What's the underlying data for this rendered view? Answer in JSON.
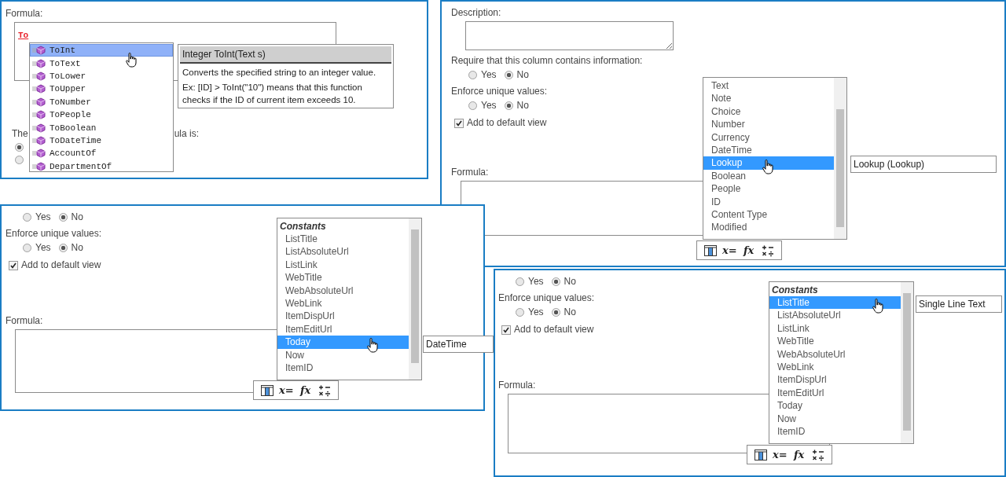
{
  "panels": [
    {
      "kind": "autocomplete",
      "formula_label": "Formula:",
      "formula_value": "To",
      "functions": [
        {
          "label": "ToInt",
          "selected": true
        },
        {
          "label": "ToText",
          "selected": false
        },
        {
          "label": "ToLower",
          "selected": false
        },
        {
          "label": "ToUpper",
          "selected": false
        },
        {
          "label": "ToNumber",
          "selected": false
        },
        {
          "label": "ToPeople",
          "selected": false
        },
        {
          "label": "ToBoolean",
          "selected": false
        },
        {
          "label": "ToDateTime",
          "selected": false
        },
        {
          "label": "AccountOf",
          "selected": false
        },
        {
          "label": "DepartmentOf",
          "selected": false
        }
      ],
      "tooltip": {
        "signature": "Integer ToInt(Text s)",
        "description": "Converts the specified string to an integer value.",
        "example": "Ex: [ID] > ToInt(\"10\") means that this function checks if the ID of current item exceeds 10."
      },
      "result_label_start": "The",
      "result_label_end": "ula is:",
      "result_options": [
        {
          "selected": true
        },
        {
          "selected": false
        }
      ]
    },
    {
      "kind": "settings",
      "description_label": "Description:",
      "require_label": "Require that this column contains information:",
      "require_options": [
        {
          "label": "Yes",
          "selected": false
        },
        {
          "label": "No",
          "selected": true
        }
      ],
      "unique_label": "Enforce unique values:",
      "unique_options": [
        {
          "label": "Yes",
          "selected": false
        },
        {
          "label": "No",
          "selected": true
        }
      ],
      "default_view": {
        "label": "Add to default view",
        "checked": true
      },
      "formula_label": "Formula:",
      "items": [
        {
          "label": "Text",
          "selected": false
        },
        {
          "label": "Note",
          "selected": false
        },
        {
          "label": "Choice",
          "selected": false
        },
        {
          "label": "Number",
          "selected": false
        },
        {
          "label": "Currency",
          "selected": false
        },
        {
          "label": "DateTime",
          "selected": false
        },
        {
          "label": "Lookup",
          "selected": true
        },
        {
          "label": "Boolean",
          "selected": false
        },
        {
          "label": "People",
          "selected": false
        },
        {
          "label": "ID",
          "selected": false
        },
        {
          "label": "Content Type",
          "selected": false
        },
        {
          "label": "Modified",
          "selected": false
        }
      ],
      "type_value": "Lookup (Lookup)",
      "toolbar": [
        {
          "kind": "fields"
        },
        {
          "kind": "glyph",
          "text": "x="
        },
        {
          "kind": "glyph",
          "text": "fx"
        },
        {
          "kind": "operators"
        }
      ]
    },
    {
      "kind": "settings",
      "require_options": [
        {
          "label": "Yes",
          "selected": false
        },
        {
          "label": "No",
          "selected": true
        }
      ],
      "unique_label": "Enforce unique values:",
      "unique_options": [
        {
          "label": "Yes",
          "selected": false
        },
        {
          "label": "No",
          "selected": true
        }
      ],
      "default_view": {
        "label": "Add to default view",
        "checked": true
      },
      "formula_label": "Formula:",
      "list_heading": "Constants",
      "items": [
        {
          "label": "ListTitle",
          "selected": false
        },
        {
          "label": "ListAbsoluteUrl",
          "selected": false
        },
        {
          "label": "ListLink",
          "selected": false
        },
        {
          "label": "WebTitle",
          "selected": false
        },
        {
          "label": "WebAbsoluteUrl",
          "selected": false
        },
        {
          "label": "WebLink",
          "selected": false
        },
        {
          "label": "ItemDispUrl",
          "selected": false
        },
        {
          "label": "ItemEditUrl",
          "selected": false
        },
        {
          "label": "Today",
          "selected": true
        },
        {
          "label": "Now",
          "selected": false
        },
        {
          "label": "ItemID",
          "selected": false
        }
      ],
      "type_value": "DateTime",
      "toolbar": [
        {
          "kind": "fields"
        },
        {
          "kind": "glyph",
          "text": "x="
        },
        {
          "kind": "glyph",
          "text": "fx"
        },
        {
          "kind": "operators"
        }
      ]
    },
    {
      "kind": "settings",
      "require_options": [
        {
          "label": "Yes",
          "selected": false
        },
        {
          "label": "No",
          "selected": true
        }
      ],
      "unique_label": "Enforce unique values:",
      "unique_options": [
        {
          "label": "Yes",
          "selected": false
        },
        {
          "label": "No",
          "selected": true
        }
      ],
      "default_view": {
        "label": "Add to default view",
        "checked": true
      },
      "formula_label": "Formula:",
      "list_heading": "Constants",
      "items": [
        {
          "label": "ListTitle",
          "selected": true
        },
        {
          "label": "ListAbsoluteUrl",
          "selected": false
        },
        {
          "label": "ListLink",
          "selected": false
        },
        {
          "label": "WebTitle",
          "selected": false
        },
        {
          "label": "WebAbsoluteUrl",
          "selected": false
        },
        {
          "label": "WebLink",
          "selected": false
        },
        {
          "label": "ItemDispUrl",
          "selected": false
        },
        {
          "label": "ItemEditUrl",
          "selected": false
        },
        {
          "label": "Today",
          "selected": false
        },
        {
          "label": "Now",
          "selected": false
        },
        {
          "label": "ItemID",
          "selected": false
        }
      ],
      "type_value": "Single Line Text",
      "toolbar": [
        {
          "kind": "fields"
        },
        {
          "kind": "glyph",
          "text": "x="
        },
        {
          "kind": "glyph",
          "text": "fx"
        },
        {
          "kind": "operators"
        }
      ]
    }
  ]
}
